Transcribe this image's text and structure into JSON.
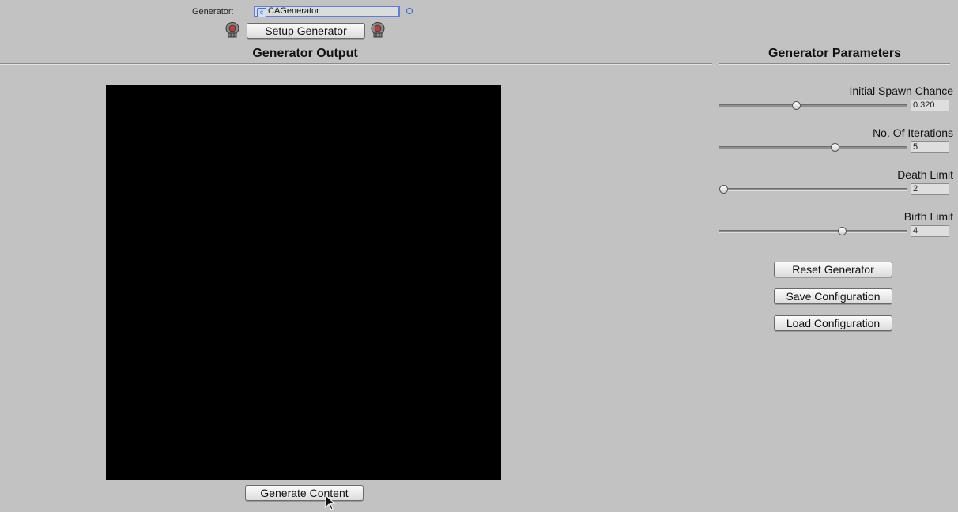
{
  "generator_row": {
    "label": "Generator:",
    "field_value": "CAGenerator",
    "field_icon": "script-asset-icon",
    "setup_button": "Setup Generator"
  },
  "output": {
    "title": "Generator Output",
    "generate_button": "Generate Content",
    "grid": {
      "cols": 50,
      "rows": 50,
      "wall_color": "#000000",
      "floor_color": "#ffffff",
      "cells_rle": "50B|50B|50B|50B|50B|50B|50B|50B|50B|50B|50B|50B|50B|50B|50B|50B|50B|50B|50B|50B|50B|50B|50B|50B|50B|50B|50B|50B|50B|50B|50B|50B|50B|50B|50B|50B|50B|50B|50B|50B|50B|50B|50B|50B|50B|50B|50B|50B|50B|50B"
    }
  },
  "parameters": {
    "title": "Generator Parameters",
    "items": [
      {
        "name": "Initial Spawn Chance",
        "value": "0.320",
        "fraction": 0.404
      },
      {
        "name": "No. Of Iterations",
        "value": "5",
        "fraction": 0.62
      },
      {
        "name": "Death Limit",
        "value": "2",
        "fraction": 0.0
      },
      {
        "name": "Birth Limit",
        "value": "4",
        "fraction": 0.66
      }
    ],
    "buttons": {
      "reset": "Reset Generator",
      "save": "Save Configuration",
      "load": "Load Configuration"
    }
  }
}
